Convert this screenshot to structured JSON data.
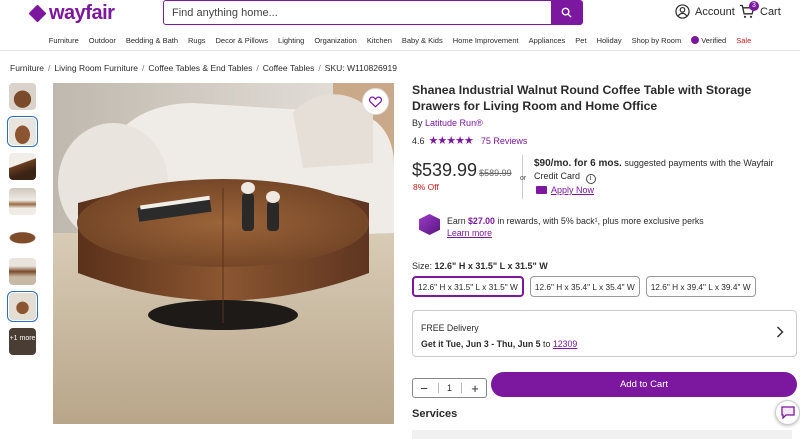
{
  "brand": {
    "logo_text": "wayfair",
    "color": "#7b189f"
  },
  "search": {
    "placeholder": "Find anything home..."
  },
  "header": {
    "account_label": "Account",
    "cart_label": "Cart",
    "cart_count": "3"
  },
  "nav": {
    "items": [
      "Furniture",
      "Outdoor",
      "Bedding & Bath",
      "Rugs",
      "Decor & Pillows",
      "Lighting",
      "Organization",
      "Kitchen",
      "Baby & Kids",
      "Home Improvement",
      "Appliances",
      "Pet",
      "Holiday",
      "Shop by Room",
      "Verified",
      "Sale"
    ]
  },
  "breadcrumb": {
    "items": [
      "Furniture",
      "Living Room Furniture",
      "Coffee Tables & End Tables",
      "Coffee Tables"
    ],
    "sku": "SKU: W110826919"
  },
  "thumbnails": {
    "more_label": "+1 more"
  },
  "product": {
    "title": "Shanea Industrial Walnut Round Coffee Table with Storage Drawers for Living Room and Home Office",
    "by_prefix": "By",
    "brand": "Latitude Run®",
    "rating": "4.6",
    "stars": "★★★★★",
    "reviews": "75 Reviews",
    "price": "$539.99",
    "was_price": "$589.99",
    "discount": "8% Off",
    "or": "or",
    "monthly_bold": "$90/mo. for 6 mos.",
    "monthly_rest": " suggested payments with the Wayfair Credit Card",
    "apply_label": "Apply Now",
    "rewards_pre": "Earn ",
    "rewards_amt": "$27.00",
    "rewards_post": " in rewards, with 5% back¹, plus more exclusive perks",
    "learn_more": "Learn more",
    "size_prefix": "Size:",
    "size_selected": "12.6\" H x 31.5\" L x 31.5\" W",
    "sizes": [
      "12.6\" H x 31.5\" L x 31.5\" W",
      "12.6\" H x 35.4\" L x 35.4\" W",
      "12.6\" H x 39.4\" L x 39.4\" W"
    ],
    "delivery_title": "FREE Delivery",
    "delivery_get": "Get it Tue, Jun 3 - Thu, Jun 5",
    "delivery_to": "to",
    "zip": "12309",
    "qty": "1",
    "qty_minus": "−",
    "qty_plus": "+",
    "add_to_cart": "Add to Cart",
    "services_heading": "Services"
  }
}
